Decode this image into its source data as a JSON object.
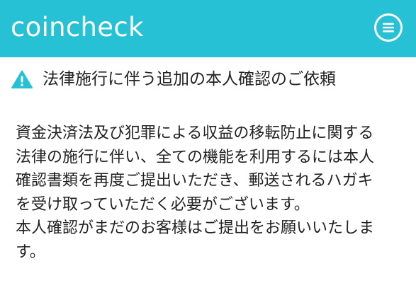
{
  "header": {
    "brand": "coincheck",
    "menu_icon": "hamburger-menu-icon",
    "background_color": "#26c1d4"
  },
  "notice": {
    "icon": "warning-triangle-icon",
    "icon_color": "#26c1d4",
    "title": "法律施行に伴う追加の本人確認のご依頼",
    "body_lines": [
      "資金決済法及び犯罪による収益の移転防止に関する",
      "法律の施行に伴い、全ての機能を利用するには本人",
      "確認書類を再度ご提出いただき、郵送されるハガキ",
      "を受け取っていただく必要がございます。",
      "本人確認がまだのお客様はご提出をお願いいたしま",
      "す。"
    ]
  }
}
